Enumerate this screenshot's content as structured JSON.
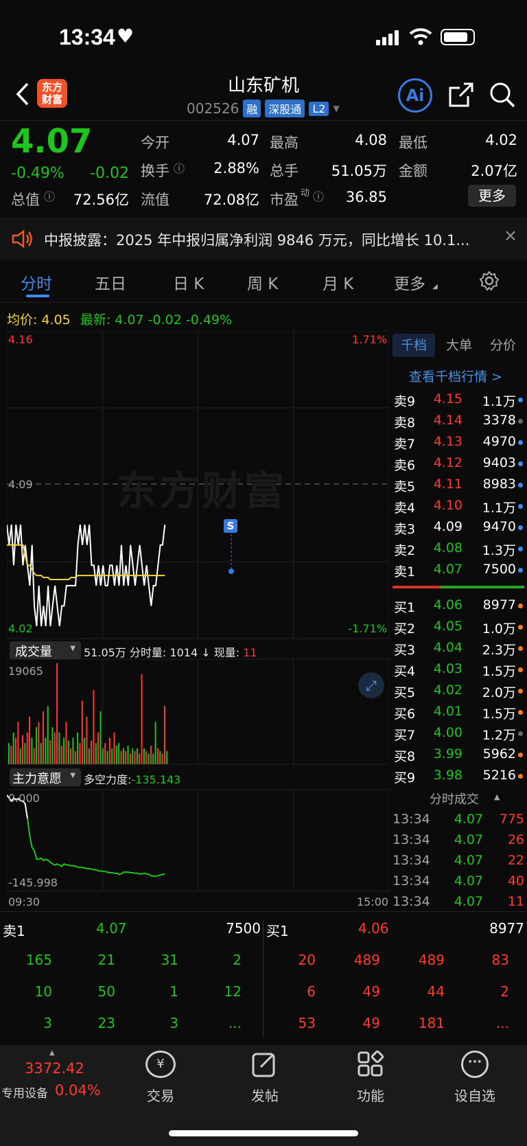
{
  "status_bar": {
    "time": "13:34"
  },
  "header": {
    "title": "山东矿机",
    "code": "002526",
    "tags": [
      "融",
      "深股通",
      "L2"
    ],
    "logo": "东方财富",
    "ai_label": "Ai"
  },
  "quote": {
    "price": "4.07",
    "change_pct": "-0.49%",
    "change": "-0.02",
    "fields": [
      {
        "label": "今开",
        "value": "4.07",
        "color": "green"
      },
      {
        "label": "最高",
        "value": "4.08",
        "color": "green"
      },
      {
        "label": "最低",
        "value": "4.02",
        "color": "green"
      },
      {
        "label": "换手",
        "value": "2.88%",
        "color": "white"
      },
      {
        "label": "总手",
        "value": "51.05万",
        "color": "white"
      },
      {
        "label": "金额",
        "value": "2.07亿",
        "color": "white"
      },
      {
        "label": "总值",
        "value": "72.56亿",
        "color": "white"
      },
      {
        "label": "流值",
        "value": "72.08亿",
        "color": "white"
      },
      {
        "label": "市盈",
        "label_sup": "动",
        "value": "36.85",
        "color": "white"
      }
    ],
    "more_label": "更多"
  },
  "notice": {
    "text": "中报披露：2025 年中报归属净利润 9846 万元，同比增长 10.1..."
  },
  "tabs": [
    "分时",
    "五日",
    "日 K",
    "周 K",
    "月 K",
    "更多"
  ],
  "avg_line": {
    "avg_label": "均价:",
    "avg_value": "4.05",
    "latest_label": "最新:",
    "latest_value": "4.07",
    "change": "-0.02",
    "change_pct": "-0.49%"
  },
  "chart_axis": {
    "top_price": "4.16",
    "top_pct": "1.71%",
    "mid_price": "4.09",
    "bottom_price": "4.02",
    "bottom_pct": "-1.71%",
    "watermark": "东方财富",
    "marker": "S"
  },
  "volume": {
    "selector": "成交量",
    "total": "51.05万",
    "minute_label": "分时量:",
    "minute_value": "1014",
    "arrow": "↓",
    "current_label": "现量:",
    "current_value": "11",
    "max": "19065"
  },
  "capital": {
    "selector": "主力意愿",
    "label": "多空力度:",
    "value": "-135.143",
    "top": "0.000",
    "bottom": "-145.998",
    "start_time": "09:30",
    "end_time": "15:00"
  },
  "side_tabs": [
    "千档",
    "大单",
    "分价"
  ],
  "side_link": "查看千档行情 >",
  "asks": [
    {
      "label": "卖9",
      "price": "4.15",
      "vol": "1.1万",
      "dot": "#3b8df0"
    },
    {
      "label": "卖8",
      "price": "4.14",
      "vol": "3378",
      "dot": "#6b6b6b"
    },
    {
      "label": "卖7",
      "price": "4.13",
      "vol": "4970",
      "dot": "#3b8df0"
    },
    {
      "label": "卖6",
      "price": "4.12",
      "vol": "9403",
      "dot": "#3b8df0"
    },
    {
      "label": "卖5",
      "price": "4.11",
      "vol": "8983",
      "dot": "#3b8df0"
    },
    {
      "label": "卖4",
      "price": "4.10",
      "vol": "1.1万",
      "dot": "#3b8df0"
    },
    {
      "label": "卖3",
      "price": "4.09",
      "vol": "9470",
      "dot": "#3b8df0"
    },
    {
      "label": "卖2",
      "price": "4.08",
      "vol": "1.3万",
      "dot": "#3b8df0"
    },
    {
      "label": "卖1",
      "price": "4.07",
      "vol": "7500",
      "dot": "#3b8df0"
    }
  ],
  "bids": [
    {
      "label": "买1",
      "price": "4.06",
      "vol": "8977",
      "dot": "#ff7a1a"
    },
    {
      "label": "买2",
      "price": "4.05",
      "vol": "1.0万",
      "dot": "#ff7a1a"
    },
    {
      "label": "买3",
      "price": "4.04",
      "vol": "2.3万",
      "dot": "#ff7a1a"
    },
    {
      "label": "买4",
      "price": "4.03",
      "vol": "1.5万",
      "dot": "#ff7a1a"
    },
    {
      "label": "买5",
      "price": "4.02",
      "vol": "2.0万",
      "dot": "#ff7a1a"
    },
    {
      "label": "买6",
      "price": "4.01",
      "vol": "1.5万",
      "dot": "#ff7a1a"
    },
    {
      "label": "买7",
      "price": "4.00",
      "vol": "1.2万",
      "dot": "#6b6b6b"
    },
    {
      "label": "买8",
      "price": "3.99",
      "vol": "5962",
      "dot": "#ff7a1a"
    },
    {
      "label": "买9",
      "price": "3.98",
      "vol": "5216",
      "dot": "#ff7a1a"
    }
  ],
  "ticks_title": "分时成交",
  "ticks": [
    {
      "time": "13:34",
      "price": "4.07",
      "vol": "775"
    },
    {
      "time": "13:34",
      "price": "4.07",
      "vol": "26"
    },
    {
      "time": "13:34",
      "price": "4.07",
      "vol": "22"
    },
    {
      "time": "13:34",
      "price": "4.07",
      "vol": "40"
    },
    {
      "time": "13:34",
      "price": "4.07",
      "vol": "11"
    }
  ],
  "queue": {
    "sell": {
      "label": "卖1",
      "price": "4.07",
      "vol": "7500",
      "rows": [
        [
          "165",
          "21",
          "31",
          "2"
        ],
        [
          "10",
          "50",
          "1",
          "12"
        ],
        [
          "3",
          "23",
          "3",
          "..."
        ]
      ]
    },
    "buy": {
      "label": "买1",
      "price": "4.06",
      "vol": "8977",
      "rows": [
        [
          "20",
          "489",
          "489",
          "83"
        ],
        [
          "6",
          "49",
          "44",
          "2"
        ],
        [
          "53",
          "49",
          "181",
          "..."
        ]
      ]
    }
  },
  "bottom": {
    "index_value": "3372.42",
    "index_name": "专用设备",
    "index_pct": "0.04%",
    "nav": [
      "交易",
      "发帖",
      "功能",
      "设自选"
    ]
  },
  "chart_data": {
    "type": "line",
    "title": "",
    "x_range": [
      "09:30",
      "15:00"
    ],
    "ylim": [
      4.02,
      4.16
    ],
    "reference_price": 4.09,
    "series": [
      {
        "values": [
          4.07,
          4.06,
          4.07,
          4.05,
          4.07,
          4.06,
          4.07,
          4.05,
          4.06,
          4.05,
          4.04,
          4.06,
          4.03,
          4.02,
          4.04,
          4.02,
          4.03,
          4.02,
          4.04,
          4.02,
          4.03,
          4.04,
          4.03,
          4.02,
          4.03,
          4.03,
          4.04,
          4.04,
          4.04,
          4.04,
          4.04,
          4.06,
          4.07,
          4.06,
          4.07,
          4.06,
          4.07,
          4.05,
          4.05,
          4.04,
          4.05,
          4.04,
          4.05,
          4.04,
          4.04,
          4.05,
          4.05,
          4.04,
          4.05,
          4.04,
          4.06,
          4.04,
          4.05,
          4.04,
          4.06,
          4.05,
          4.04,
          4.05,
          4.06,
          4.05,
          4.04,
          4.05,
          4.04,
          4.03,
          4.04,
          4.04,
          4.05,
          4.06,
          4.06,
          4.07
        ]
      },
      {
        "values": [
          4.06,
          4.06,
          4.06,
          4.06,
          4.06,
          4.06,
          4.06,
          4.06,
          4.055,
          4.05,
          4.05,
          4.048,
          4.046,
          4.045,
          4.045,
          4.045,
          4.044,
          4.044,
          4.044,
          4.043,
          4.043,
          4.043,
          4.043,
          4.043,
          4.043,
          4.043,
          4.043,
          4.043,
          4.044,
          4.044,
          4.044,
          4.045,
          4.045,
          4.045,
          4.045,
          4.045,
          4.045,
          4.045,
          4.045,
          4.045,
          4.045,
          4.045,
          4.045,
          4.045,
          4.045,
          4.045,
          4.045,
          4.045,
          4.045,
          4.045,
          4.045,
          4.045,
          4.045,
          4.045,
          4.045,
          4.045,
          4.045,
          4.045,
          4.045,
          4.045,
          4.045,
          4.045,
          4.045,
          4.045,
          4.045,
          4.045,
          4.045,
          4.045,
          4.045,
          4.045
        ]
      }
    ],
    "volume_values": [
      4000,
      3500,
      6000,
      5000,
      8000,
      3000,
      5500,
      4000,
      6000,
      9000,
      5000,
      3000,
      7000,
      8000,
      4000,
      10000,
      5000,
      11000,
      4500,
      7000,
      6000,
      19065,
      6000,
      3500,
      5000,
      8000,
      4500,
      3000,
      5000,
      2500,
      6000,
      4000,
      12000,
      5000,
      9000,
      3000,
      4500,
      14000,
      4000,
      6000,
      10000,
      3000,
      4000,
      2500,
      5000,
      3000,
      6000,
      3500,
      4000,
      2500,
      3000,
      2500,
      3500,
      2000,
      3000,
      2500,
      3000,
      2000,
      17000,
      3000,
      2500,
      2000,
      3500,
      2000,
      8000,
      3000,
      2500,
      2000,
      11000,
      2500
    ],
    "volume_colors": [
      "g",
      "r",
      "g",
      "r",
      "r",
      "g",
      "r",
      "g",
      "r",
      "r",
      "g",
      "r",
      "g",
      "r",
      "g",
      "r",
      "g",
      "g",
      "r",
      "g",
      "r",
      "r",
      "g",
      "r",
      "g",
      "r",
      "g",
      "r",
      "g",
      "r",
      "g",
      "r",
      "r",
      "g",
      "r",
      "g",
      "r",
      "r",
      "g",
      "r",
      "g",
      "g",
      "r",
      "g",
      "r",
      "g",
      "r",
      "g",
      "g",
      "r",
      "g",
      "r",
      "g",
      "r",
      "g",
      "r",
      "g",
      "r",
      "r",
      "g",
      "r",
      "g",
      "r",
      "g",
      "g",
      "r",
      "g",
      "r",
      "r",
      "g"
    ],
    "capital_values": [
      0,
      -5,
      -10,
      -5,
      -8,
      -6,
      -10,
      -10,
      -15,
      -40,
      -70,
      -90,
      -95,
      -110,
      -110,
      -108,
      -112,
      -110,
      -112,
      -115,
      -118,
      -120,
      -118,
      -120,
      -122,
      -118,
      -120,
      -120,
      -121,
      -121,
      -122,
      -124,
      -124,
      -124,
      -125,
      -126,
      -126,
      -127,
      -128,
      -128,
      -130,
      -130,
      -131,
      -131,
      -132,
      -133,
      -133,
      -134,
      -134,
      -136,
      -135,
      -132,
      -132,
      -132,
      -133,
      -133,
      -134,
      -134,
      -135,
      -135,
      -134,
      -135,
      -136,
      -138,
      -139,
      -139,
      -138,
      -137,
      -136,
      -135
    ]
  }
}
